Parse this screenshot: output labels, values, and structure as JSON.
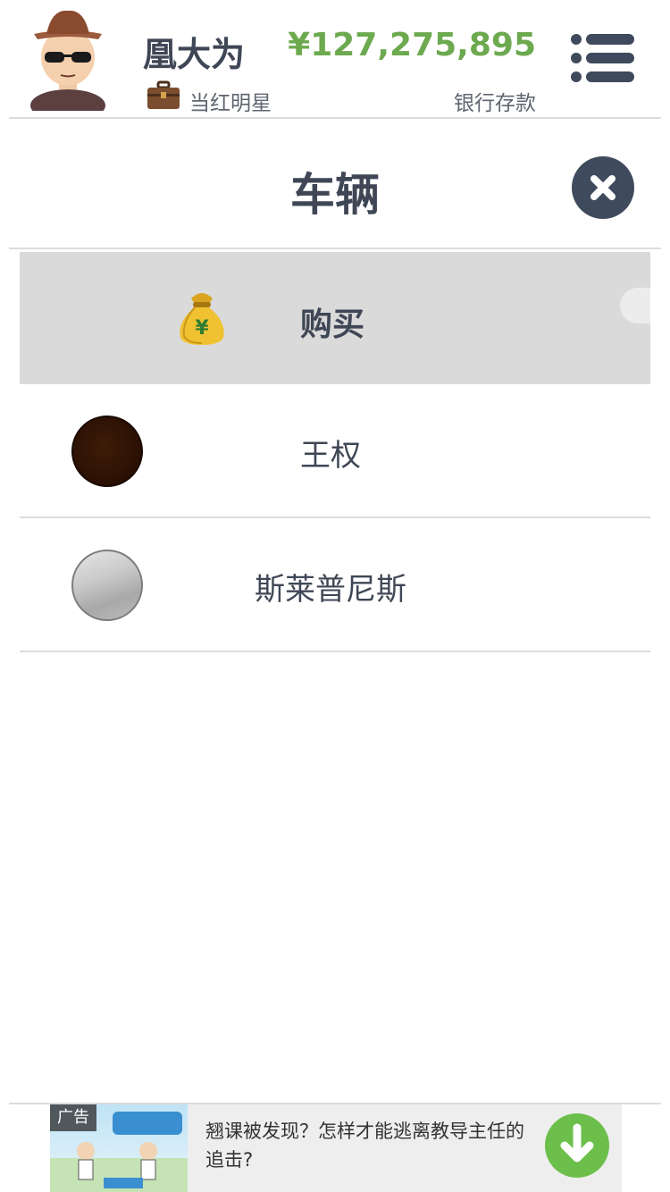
{
  "header": {
    "player_name": "凰大为",
    "job_title": "当红明星",
    "money": "¥127,275,895",
    "money_label": "银行存款"
  },
  "section": {
    "title": "车辆"
  },
  "buy_row": {
    "label": "购买"
  },
  "cars": [
    {
      "name": "王权",
      "color": "#2a1003"
    },
    {
      "name": "斯莱普尼斯",
      "color": "#bdbdbd"
    }
  ],
  "ad": {
    "tag": "广告",
    "text": "翘课被发现？怎样才能逃离教导主任的追击?"
  },
  "colors": {
    "accent_green": "#6ca94f",
    "dark_slate": "#3f4a5c"
  }
}
